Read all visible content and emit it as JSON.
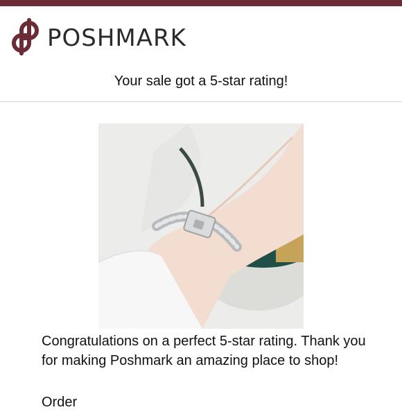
{
  "brand": {
    "name": "POSHMARK",
    "icon": "poshmark-logo-icon",
    "color": "#6b2c36"
  },
  "email": {
    "subject_line": "Your sale got a 5-star rating!",
    "photo_icon": "product-photo-bracelet",
    "message": "Congratulations on a perfect 5-star rating. Thank you for making Poshmark an amazing place to shop!",
    "next_section": "Order"
  }
}
